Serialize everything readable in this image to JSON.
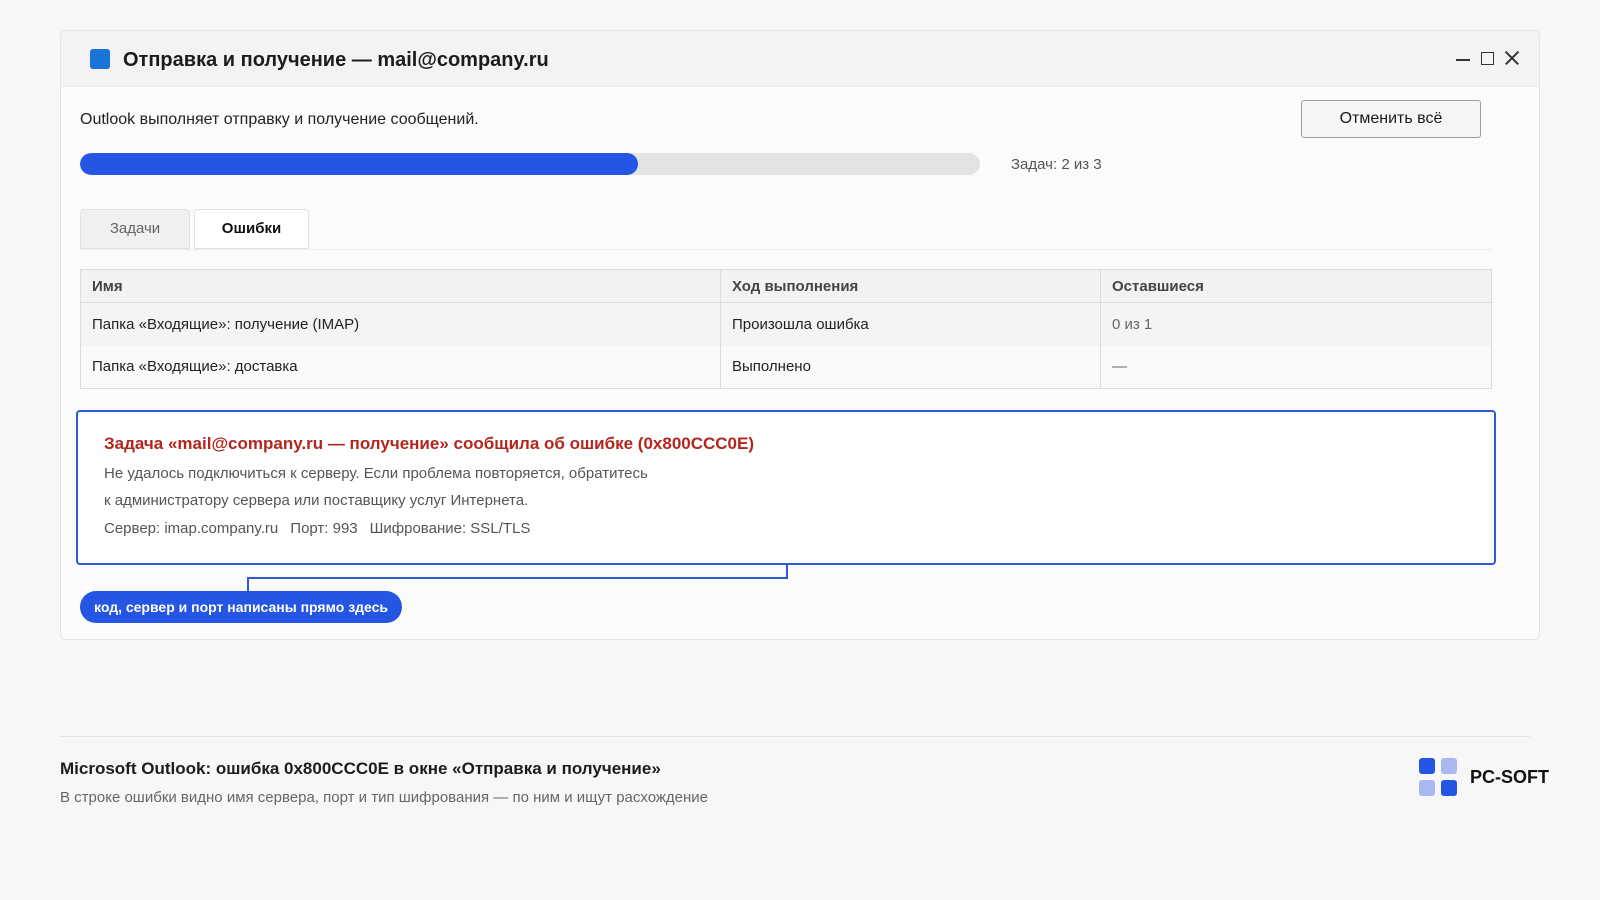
{
  "window": {
    "title": "Отправка и получение — mail@company.ru",
    "status_text": "Outlook выполняет отправку и получение сообщений.",
    "cancel_all_label": "Отменить всё",
    "progress": {
      "fraction": 0.62,
      "label": "Задач: 2 из 3"
    },
    "icon_color": "#1a73d9"
  },
  "tabs": [
    {
      "label": "Задачи",
      "active": false
    },
    {
      "label": "Ошибки",
      "active": true
    }
  ],
  "table": {
    "headers": [
      "Имя",
      "Ход выполнения",
      "Оставшиеся"
    ],
    "rows": [
      {
        "name": "Папка «Входящие»: получение (IMAP)",
        "progress": "Произошла ошибка",
        "remaining": "0 из 1"
      },
      {
        "name": "Папка «Входящие»: доставка",
        "progress": "Выполнено",
        "remaining": "—"
      }
    ]
  },
  "error": {
    "title": "Задача «mail@company.ru — получение» сообщила об ошибке (0x800CCC0E)",
    "line1": "Не удалось подключиться к серверу. Если проблема повторяется, обратитесь",
    "line2": "к администратору сервера или поставщику услуг Интернета.",
    "server": "Сервер: imap.company.ru",
    "port": "Порт: 993",
    "encryption": "Шифрование: SSL/TLS"
  },
  "callout": {
    "text": "код, сервер и порт написаны прямо здесь"
  },
  "footer": {
    "title": "Microsoft Outlook: ошибка 0x800CCC0E в окне «Отправка и получение»",
    "subtitle": "В строке ошибки видно имя сервера, порт и тип шифрования — по ним и ищут расхождение",
    "brand": "PC-SOFT"
  },
  "colors": {
    "accent": "#2456e3",
    "error_red": "#b3261e",
    "logo_dark": "#2456e3",
    "logo_light": "#a9b9f0"
  }
}
